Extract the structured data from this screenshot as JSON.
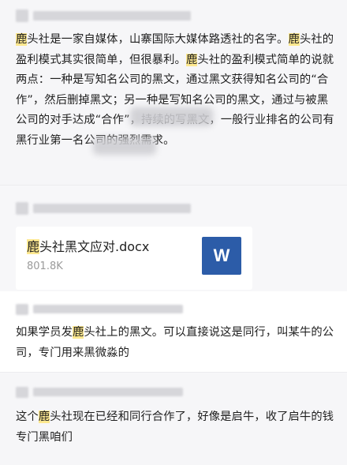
{
  "colors": {
    "highlight": "#fde88f",
    "word_icon_bg": "#2c5ca8",
    "page_bg": "#f6f6f8"
  },
  "messages": [
    {
      "runs": [
        {
          "text": "鹿",
          "hl": true
        },
        {
          "text": "头社是一家自媒体，山寨国际大媒体路透社的名字。",
          "hl": false
        },
        {
          "text": "鹿",
          "hl": true
        },
        {
          "text": "头社的盈利模式其实很简单，但很暴利。",
          "hl": false
        },
        {
          "text": "鹿",
          "hl": true
        },
        {
          "text": "头社的盈利模式简单的说就两点：一种是写知名公司的黑文，通过黑文获得知名公司的“合作”，然后删掉黑文；另一种是写知名公司的黑文，通过与被黑公司的对手达成“合作”，持续的写黑文，一般行业排名的公司有黑行业第一名公司的强烈需求。",
          "hl": false
        }
      ]
    },
    {
      "runs": [
        {
          "text": "如果学员发",
          "hl": false
        },
        {
          "text": "鹿",
          "hl": true
        },
        {
          "text": "头社上的黑文。可以直接说这是同行，叫某牛的公司，专门用来黑微淼的",
          "hl": false
        }
      ]
    },
    {
      "runs": [
        {
          "text": "这个",
          "hl": false
        },
        {
          "text": "鹿",
          "hl": true
        },
        {
          "text": "头社现在已经和同行合作了，好像是启牛，收了启牛的钱专门黑咱们",
          "hl": false
        }
      ]
    }
  ],
  "file": {
    "name_highlight": "鹿",
    "name_rest": "头社黑文应对.docx",
    "size": "801.8K",
    "icon": "word-doc-icon",
    "icon_letter": "W"
  }
}
